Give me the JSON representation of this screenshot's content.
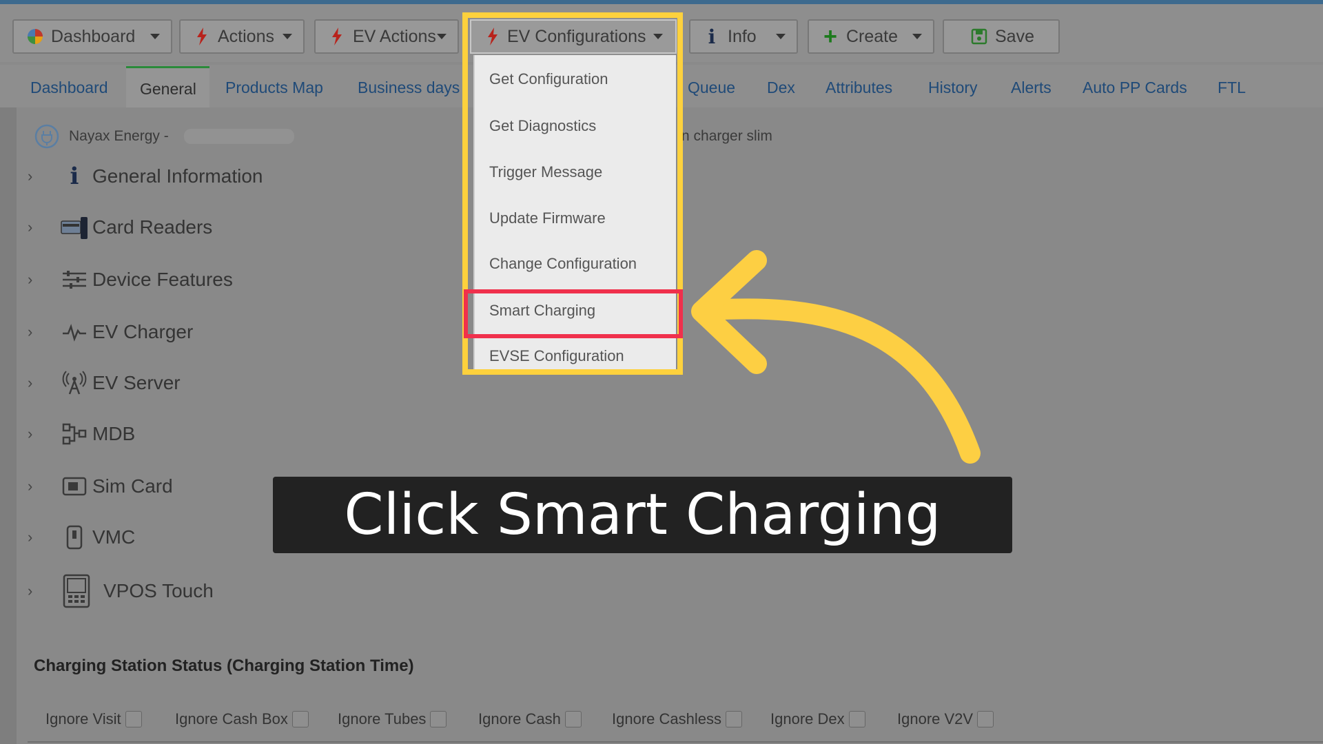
{
  "toolbar": {
    "buttons": [
      {
        "label": "Dashboard"
      },
      {
        "label": "Actions"
      },
      {
        "label": "EV Actions"
      },
      {
        "label": "EV Configurations"
      },
      {
        "label": "Info"
      },
      {
        "label": "Create"
      },
      {
        "label": "Save"
      }
    ]
  },
  "tabs": [
    "Dashboard",
    "General",
    "Products Map",
    "Business days",
    "Queue",
    "Dex",
    "Attributes",
    "History",
    "Alerts",
    "Auto PP Cards",
    "FTL"
  ],
  "active_tab": "General",
  "device": {
    "name": "Nayax Energy -",
    "model_suffix": "n charger slim"
  },
  "tree": [
    {
      "label": "General Information",
      "icon": "info-icon"
    },
    {
      "label": "Card Readers",
      "icon": "card-reader-icon"
    },
    {
      "label": "Device Features",
      "icon": "sliders-icon"
    },
    {
      "label": "EV Charger",
      "icon": "pulse-icon"
    },
    {
      "label": "EV Server",
      "icon": "antenna-icon"
    },
    {
      "label": "MDB",
      "icon": "mdb-icon"
    },
    {
      "label": "Sim Card",
      "icon": "sim-card-icon"
    },
    {
      "label": "VMC",
      "icon": "vmc-icon"
    },
    {
      "label": "VPOS Touch",
      "icon": "vpos-touch-icon"
    }
  ],
  "status_section": {
    "title": "Charging Station Status (Charging Station Time)",
    "checkboxes": [
      "Ignore Visit",
      "Ignore Cash Box",
      "Ignore Tubes",
      "Ignore Cash",
      "Ignore Cashless",
      "Ignore Dex",
      "Ignore V2V"
    ]
  },
  "dropdown": {
    "items": [
      "Get Configuration",
      "Get Diagnostics",
      "Trigger Message",
      "Update Firmware",
      "Change Configuration",
      "Smart Charging",
      "EVSE Configuration"
    ],
    "highlighted_item": "Smart Charging"
  },
  "instruction": {
    "caption": "Click Smart Charging"
  },
  "colors": {
    "highlight_yellow": "#fdd13d",
    "highlight_red": "#f0304c",
    "caption_bg": "#222222",
    "tab_link": "#1f4a78"
  }
}
